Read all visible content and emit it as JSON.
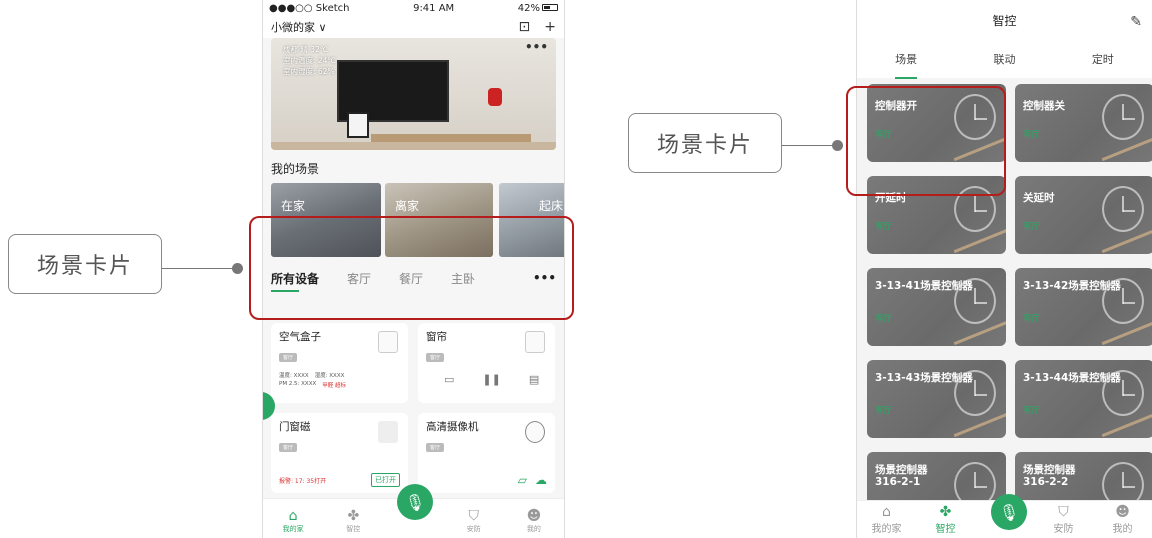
{
  "annotations": {
    "left_label": "场景卡片",
    "right_label": "场景卡片",
    "accent_color": "#b51d1d"
  },
  "phone1": {
    "status": {
      "carrier": "●●●○○ Sketch",
      "time": "9:41 AM",
      "battery": "42%"
    },
    "home_name": "小微的家 ∨",
    "banner": {
      "weather": "成都 晴 32℃",
      "indoor_temp": "室内温度: 24℃",
      "indoor_humidity": "室内湿度: 62%"
    },
    "scene_section_title": "我的场景",
    "scenes": [
      {
        "label": "在家"
      },
      {
        "label": "离家"
      },
      {
        "label": "起床"
      }
    ],
    "tabs": [
      {
        "label": "所有设备"
      },
      {
        "label": "客厅"
      },
      {
        "label": "餐厅"
      },
      {
        "label": "主卧"
      }
    ],
    "tabs_more": "•••",
    "devices": {
      "air_box": {
        "title": "空气盒子",
        "tag": "客厅",
        "temp": "温度: XXXX",
        "humidity": "湿度: XXXX",
        "pm": "PM 2.5: XXXX",
        "warning": "甲醛 超标"
      },
      "curtain": {
        "title": "窗帘",
        "tag": "客厅"
      },
      "door_sensor": {
        "title": "门窗磁",
        "tag": "客厅",
        "alarm": "报警: 17: 35打开",
        "state": "已打开"
      },
      "camera": {
        "title": "高清摄像机",
        "tag": "客厅"
      }
    },
    "bottom_nav": [
      {
        "label": "我的家"
      },
      {
        "label": "智控"
      },
      {
        "label": "安防"
      },
      {
        "label": "我的"
      }
    ],
    "green": "#2aa765"
  },
  "phone2": {
    "title": "智控",
    "tabs": [
      {
        "label": "场景"
      },
      {
        "label": "联动"
      },
      {
        "label": "定时"
      }
    ],
    "scene_cards": [
      {
        "name": "控制器开",
        "room": "客厅"
      },
      {
        "name": "控制器关",
        "room": "客厅"
      },
      {
        "name": "开延时",
        "room": "客厅"
      },
      {
        "name": "关延时",
        "room": "客厅"
      },
      {
        "name": "3-13-41场景控制器",
        "room": "客厅"
      },
      {
        "name": "3-13-42场景控制器",
        "room": "客厅"
      },
      {
        "name": "3-13-43场景控制器",
        "room": "客厅"
      },
      {
        "name": "3-13-44场景控制器",
        "room": "客厅"
      },
      {
        "name": "场景控制器316-2-1",
        "room": ""
      },
      {
        "name": "场景控制器316-2-2",
        "room": ""
      }
    ],
    "bottom_nav": [
      {
        "label": "我的家"
      },
      {
        "label": "智控"
      },
      {
        "label": "安防"
      },
      {
        "label": "我的"
      }
    ]
  }
}
